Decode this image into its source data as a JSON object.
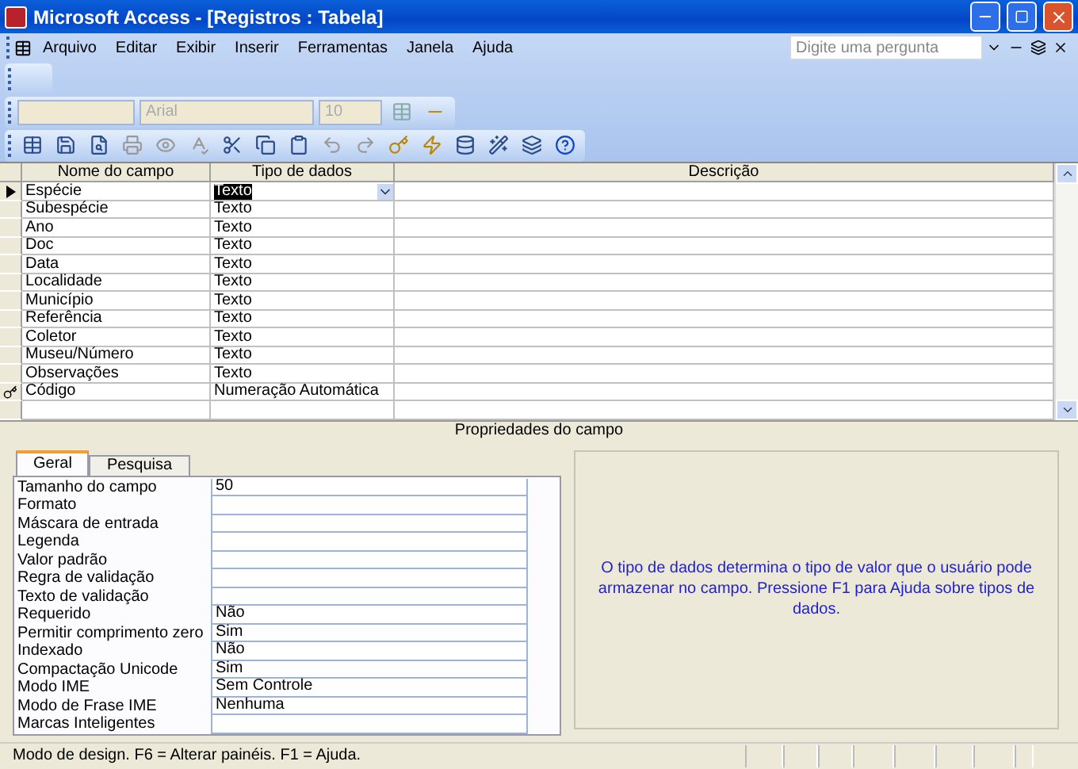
{
  "window": {
    "title": "Microsoft Access - [Registros : Tabela]"
  },
  "menu": [
    "Arquivo",
    "Editar",
    "Exibir",
    "Inserir",
    "Ferramentas",
    "Janela",
    "Ajuda"
  ],
  "help_search": {
    "placeholder": "Digite uma pergunta"
  },
  "formatting": {
    "font": "Arial",
    "size": "10",
    "disabled": true
  },
  "table": {
    "columns": [
      "Nome do campo",
      "Tipo de dados",
      "Descrição"
    ],
    "rows": [
      {
        "name": "Espécie",
        "type": "Texto",
        "selected": true,
        "primary_key": false
      },
      {
        "name": "Subespécie",
        "type": "Texto",
        "selected": false,
        "primary_key": false
      },
      {
        "name": "Ano",
        "type": "Texto",
        "selected": false,
        "primary_key": false
      },
      {
        "name": "Doc",
        "type": "Texto",
        "selected": false,
        "primary_key": false
      },
      {
        "name": "Data",
        "type": "Texto",
        "selected": false,
        "primary_key": false
      },
      {
        "name": "Localidade",
        "type": "Texto",
        "selected": false,
        "primary_key": false
      },
      {
        "name": "Município",
        "type": "Texto",
        "selected": false,
        "primary_key": false
      },
      {
        "name": "Referência",
        "type": "Texto",
        "selected": false,
        "primary_key": false
      },
      {
        "name": "Coletor",
        "type": "Texto",
        "selected": false,
        "primary_key": false
      },
      {
        "name": "Museu/Número",
        "type": "Texto",
        "selected": false,
        "primary_key": false
      },
      {
        "name": "Observações",
        "type": "Texto",
        "selected": false,
        "primary_key": false
      },
      {
        "name": "Código",
        "type": "Numeração Automática",
        "selected": false,
        "primary_key": true
      }
    ]
  },
  "properties": {
    "title": "Propriedades do campo",
    "tabs": [
      {
        "label": "Geral",
        "selected": true
      },
      {
        "label": "Pesquisa",
        "selected": false
      }
    ],
    "rows": [
      {
        "label": "Tamanho do campo",
        "value": "50"
      },
      {
        "label": "Formato"
      },
      {
        "label": "Máscara de entrada"
      },
      {
        "label": "Legenda"
      },
      {
        "label": "Valor padrão"
      },
      {
        "label": "Regra de validação"
      },
      {
        "label": "Texto de validação"
      },
      {
        "label": "Requerido",
        "value": "Não"
      },
      {
        "label": "Permitir comprimento zero",
        "value": "Sim"
      },
      {
        "label": "Indexado",
        "value": "Não"
      },
      {
        "label": "Compactação Unicode",
        "value": "Sim"
      },
      {
        "label": "Modo IME",
        "value": "Sem Controle"
      },
      {
        "label": "Modo de Frase IME",
        "value": "Nenhuma"
      },
      {
        "label": "Marcas Inteligentes"
      }
    ],
    "help_text": "O tipo de dados determina o tipo de valor que o usuário pode armazenar no campo. Pressione F1 para Ajuda sobre tipos de dados."
  },
  "status_bar": {
    "text": "Modo de design. F6 = Alterar painéis. F1 = Ajuda."
  }
}
